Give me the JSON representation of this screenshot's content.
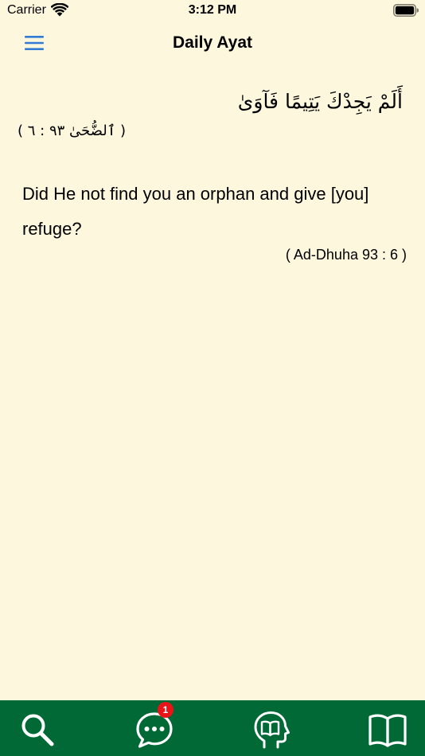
{
  "status_bar": {
    "carrier": "Carrier",
    "time": "3:12 PM"
  },
  "header": {
    "title": "Daily Ayat",
    "menu_icon": "hamburger-menu-icon"
  },
  "ayat": {
    "arabic": "أَلَمْ يَجِدْكَ يَتِيمًا فَآوَىٰ",
    "arabic_reference": "( ٱلضُّحَىٰ ٩٣ : ٦ )",
    "translation": "Did He not find you an orphan and give [you] refuge?",
    "translation_reference": "( Ad-Dhuha 93 : 6 )"
  },
  "tab_bar": {
    "background_color": "#016936",
    "items": [
      {
        "icon": "search-icon"
      },
      {
        "icon": "chat-bubble-icon",
        "badge": "1"
      },
      {
        "icon": "head-book-icon"
      },
      {
        "icon": "open-book-icon"
      }
    ]
  },
  "colors": {
    "background": "#fdf7dd",
    "accent": "#2f7bd6",
    "badge": "#e8141a"
  }
}
